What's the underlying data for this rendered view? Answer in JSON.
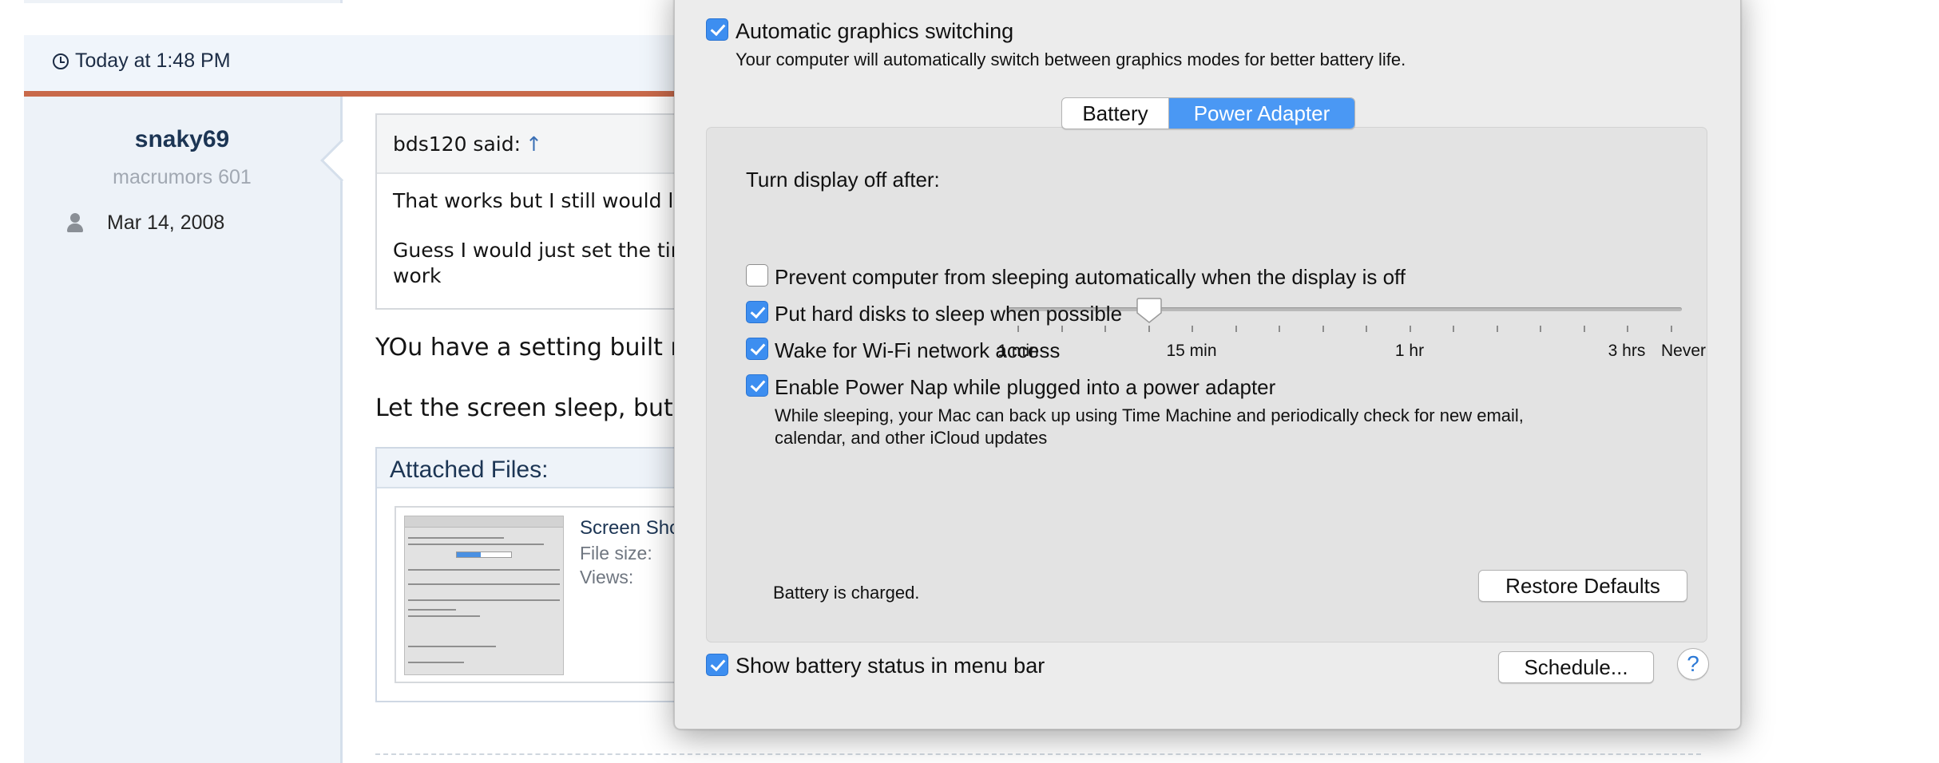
{
  "forum": {
    "post_date": "Today at 1:48 PM",
    "user": {
      "name": "snaky69",
      "title": "macrumors 601",
      "joined": "Mar 14, 2008"
    },
    "quote": {
      "author": "bds120 said:",
      "arrow": "↑",
      "line1": "That works but I still would li",
      "line2": "Guess I would just set the tin",
      "line3": "work"
    },
    "text1": "YOu have a setting built rig",
    "text2": "Let the screen sleep, but tu",
    "attachments": {
      "header": "Attached Files:",
      "item": {
        "name": "Screen Sho",
        "file_size_label": "File size:",
        "views_label": "Views:"
      }
    }
  },
  "energy_saver": {
    "auto_graphics": {
      "label": "Automatic graphics switching",
      "checked": true,
      "description": "Your computer will automatically switch between graphics modes for better battery life."
    },
    "tabs": [
      "Battery",
      "Power Adapter"
    ],
    "selected_tab": "Power Adapter",
    "display_off": {
      "label": "Turn display off after:",
      "value": "10 min",
      "tick_labels": [
        "1 min",
        "15 min",
        "1 hr",
        "3 hrs",
        "Never"
      ]
    },
    "options": [
      {
        "label": "Prevent computer from sleeping automatically when the display is off",
        "checked": false
      },
      {
        "label": "Put hard disks to sleep when possible",
        "checked": true
      },
      {
        "label": "Wake for Wi-Fi network access",
        "checked": true
      },
      {
        "label": "Enable Power Nap while plugged into a power adapter",
        "checked": true
      }
    ],
    "power_nap_description_1": "While sleeping, your Mac can back up using Time Machine and periodically check for new email,",
    "power_nap_description_2": "calendar, and other iCloud updates",
    "battery_status": "Battery is charged.",
    "restore_defaults": "Restore Defaults",
    "show_battery": {
      "label": "Show battery status in menu bar",
      "checked": true
    },
    "schedule_button": "Schedule...",
    "help_button": "?",
    "accent_color": "#4a98f4"
  }
}
